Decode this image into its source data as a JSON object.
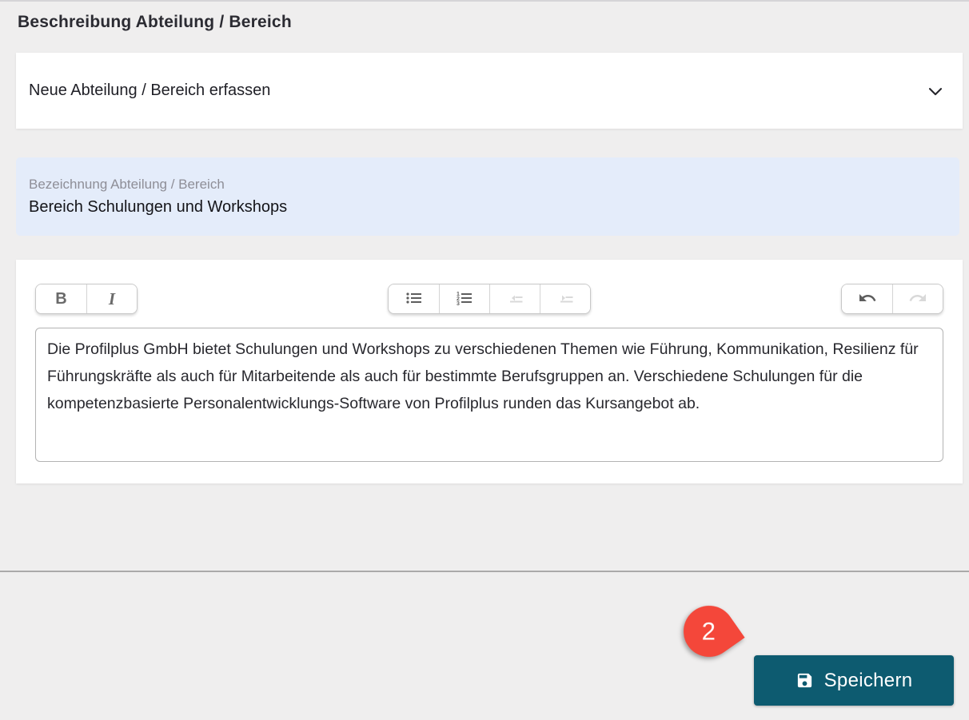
{
  "page": {
    "title": "Beschreibung Abteilung / Bereich"
  },
  "collapse_panel": {
    "label": "Neue Abteilung / Bereich erfassen",
    "chevron_icon": "chevron-down"
  },
  "name_field": {
    "label": "Bezeichnung Abteilung / Bereich",
    "value": "Bereich Schulungen und Workshops"
  },
  "editor": {
    "toolbar": {
      "bold_label": "B",
      "italic_label": "I",
      "icons": [
        "bulleted-list-icon",
        "numbered-list-icon",
        "outdent-icon",
        "indent-icon",
        "undo-icon",
        "redo-icon"
      ],
      "disabled_buttons": [
        "outdent",
        "indent",
        "redo"
      ]
    },
    "content": "Die Profilplus GmbH bietet Schulungen und Workshops zu verschiedenen Themen wie Führung, Kommunikation, Resilienz für Führungskräfte als auch für Mitarbeitende als auch für bestimmte Berufsgruppen an. Verschiedene Schulungen für die kompetenzbasierte Personalentwicklungs-Software von Profilplus runden das Kursangebot ab."
  },
  "annotation_badge": {
    "number": "2",
    "color": "#f4473a"
  },
  "save_button": {
    "label": "Speichern",
    "icon": "save-icon",
    "color": "#0d5b70"
  },
  "colors": {
    "background": "#efeeee",
    "panel": "#ffffff",
    "field_background": "#e4ecfa",
    "divider": "#aaa9a9",
    "accent_red": "#f4473a",
    "accent_teal": "#0d5b70"
  }
}
